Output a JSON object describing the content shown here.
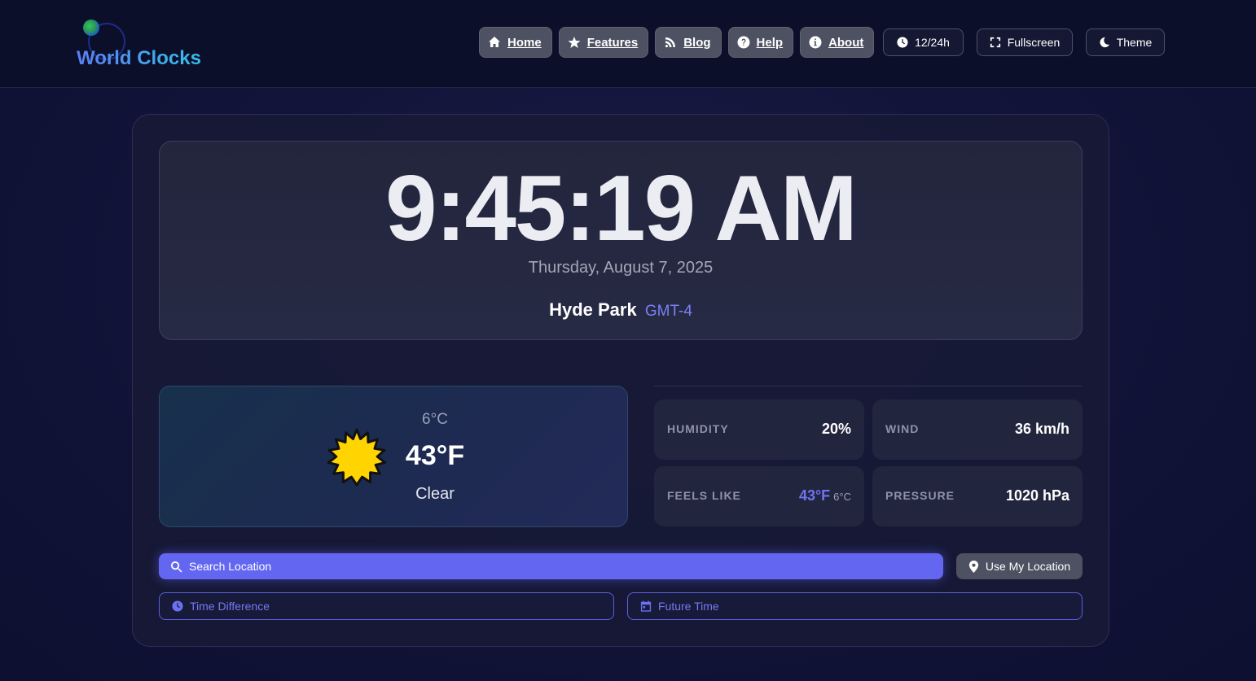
{
  "app": {
    "title": "World Clocks"
  },
  "nav": {
    "items": [
      {
        "label": "Home",
        "icon": "home-icon"
      },
      {
        "label": "Features",
        "icon": "star-icon"
      },
      {
        "label": "Blog",
        "icon": "blog-icon"
      },
      {
        "label": "Help",
        "icon": "help-icon"
      },
      {
        "label": "About",
        "icon": "info-icon"
      }
    ]
  },
  "controls": {
    "format_label": "12/24h",
    "fullscreen_label": "Fullscreen",
    "theme_label": "Theme"
  },
  "clock": {
    "time": "9:45:19 AM",
    "date": "Thursday, August 7, 2025",
    "location": "Hyde Park",
    "timezone": "GMT-4"
  },
  "weather": {
    "temp_c": "6°C",
    "temp_f": "43°F",
    "condition": "Clear",
    "icon": "sun-icon",
    "stats": {
      "humidity": {
        "label": "HUMIDITY",
        "value": "20%"
      },
      "wind": {
        "label": "WIND",
        "value": "36 km/h"
      },
      "feels_like": {
        "label": "FEELS LIKE",
        "value_f": "43°F",
        "value_c": "6°C"
      },
      "pressure": {
        "label": "PRESSURE",
        "value": "1020 hPa"
      }
    }
  },
  "search": {
    "placeholder": "Search Location",
    "use_location_label": "Use My Location",
    "time_difference_label": "Time Difference",
    "future_time_label": "Future Time"
  },
  "colors": {
    "accent": "#6366f1",
    "background": "#12143a",
    "header": "#0c0f2a"
  }
}
